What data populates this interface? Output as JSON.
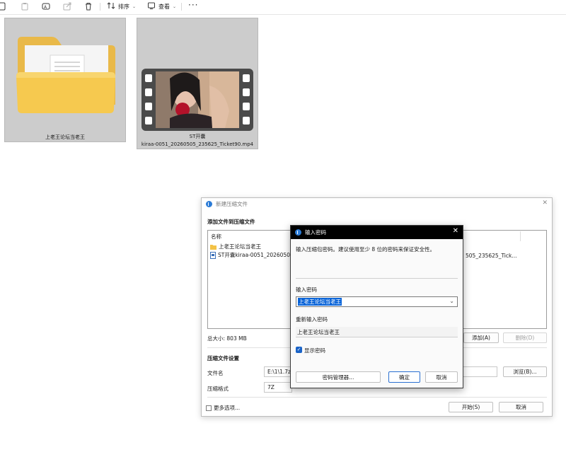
{
  "toolbar": {
    "sort_label": "排序",
    "view_label": "查看",
    "more_label": "···"
  },
  "files": [
    {
      "name": "上老王论坛当老王",
      "type": "folder"
    },
    {
      "name_line1": "ST开囊",
      "name_line2": "kiraa-0051_20260505_235625_Ticket90.mp4",
      "type": "video"
    }
  ],
  "compress_dialog": {
    "title": "新建压缩文件",
    "add_section": "添加文件到压缩文件",
    "column_name": "名称",
    "items": [
      {
        "name": "上老王论坛当老王",
        "icon": "folder-icon"
      },
      {
        "name": "ST开囊kiraa-0051_20260505_",
        "tail": "505_235625_Tick...",
        "icon": "video-file-icon"
      }
    ],
    "total_size": "总大小: 803 MB",
    "add_button": "添加(A)",
    "delete_button": "删除(D)",
    "settings_section": "压缩文件设置",
    "filename_label": "文件名",
    "filename_value": "E:\\1\\1.7z",
    "browse_button": "浏览(B)...",
    "format_label": "压缩格式",
    "format_value": "7Z",
    "more_options": "更多选项...",
    "start_button": "开始(S)",
    "cancel_button": "取消"
  },
  "password_dialog": {
    "title": "输入密码",
    "instruction": "输入压缩包密码。建议使用至少 8 位的密码来保证安全性。",
    "password_label": "输入密码",
    "password_value": "上老王论坛当老王",
    "reenter_label": "重新输入密码",
    "reenter_value": "上老王论坛当老王",
    "show_password_label": "显示密码",
    "show_password_checked": true,
    "manager_button": "密码管理器...",
    "ok_button": "确定",
    "cancel_button": "取消"
  },
  "colors": {
    "accent": "#0a64d8",
    "title_bar": "#000000",
    "tile_selected": "#cccccc"
  }
}
